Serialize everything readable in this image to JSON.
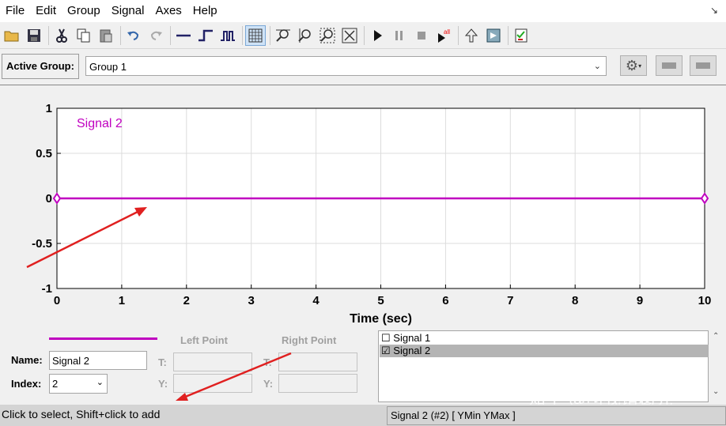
{
  "menu": [
    "File",
    "Edit",
    "Group",
    "Signal",
    "Axes",
    "Help"
  ],
  "toolbar_icons": [
    "open-folder-icon",
    "save-icon",
    "cut-icon",
    "copy-icon",
    "paste-icon",
    "undo-icon",
    "redo-icon",
    "constant-icon",
    "step-icon",
    "pulse-icon",
    "grid-icon",
    "zoom-x-icon",
    "zoom-y-icon",
    "zoom-xy-icon",
    "fit-icon",
    "play-icon",
    "pause-icon",
    "stop-icon",
    "play-all-icon",
    "move-up-icon",
    "signal-export-icon",
    "checklist-icon"
  ],
  "group": {
    "label": "Active Group:",
    "selected": "Group 1"
  },
  "chart_data": {
    "type": "line",
    "xlabel": "Time (sec)",
    "ylabel": "",
    "xlim": [
      0,
      10
    ],
    "ylim": [
      -1,
      1
    ],
    "xticks": [
      "0",
      "1",
      "2",
      "3",
      "4",
      "5",
      "6",
      "7",
      "8",
      "9",
      "10"
    ],
    "yticks": [
      "1",
      "0.5",
      "0",
      "-0.5",
      "-1"
    ],
    "grid": true,
    "series": [
      {
        "name": "Signal 2",
        "color": "#c000c0",
        "x": [
          0,
          10
        ],
        "y": [
          0,
          0
        ]
      }
    ]
  },
  "panel": {
    "name_label": "Name:",
    "name_value": "Signal 2",
    "index_label": "Index:",
    "index_value": "2",
    "left_point": "Left Point",
    "right_point": "Right Point",
    "t_label": "T:",
    "y_label": "Y:"
  },
  "signals": [
    {
      "label": "Signal 1",
      "checked": false,
      "selected": false,
      "mark": "☐"
    },
    {
      "label": "Signal 2",
      "checked": true,
      "selected": true,
      "mark": "☑"
    }
  ],
  "status": {
    "left": "Click to select, Shift+click to add",
    "right": "Signal 2 (#2)  [ YMin YMax ]"
  },
  "watermark": "知乎 @叫我诸葛亮",
  "colors": {
    "signal": "#c000c0",
    "annotation_arrow": "#e02020"
  }
}
